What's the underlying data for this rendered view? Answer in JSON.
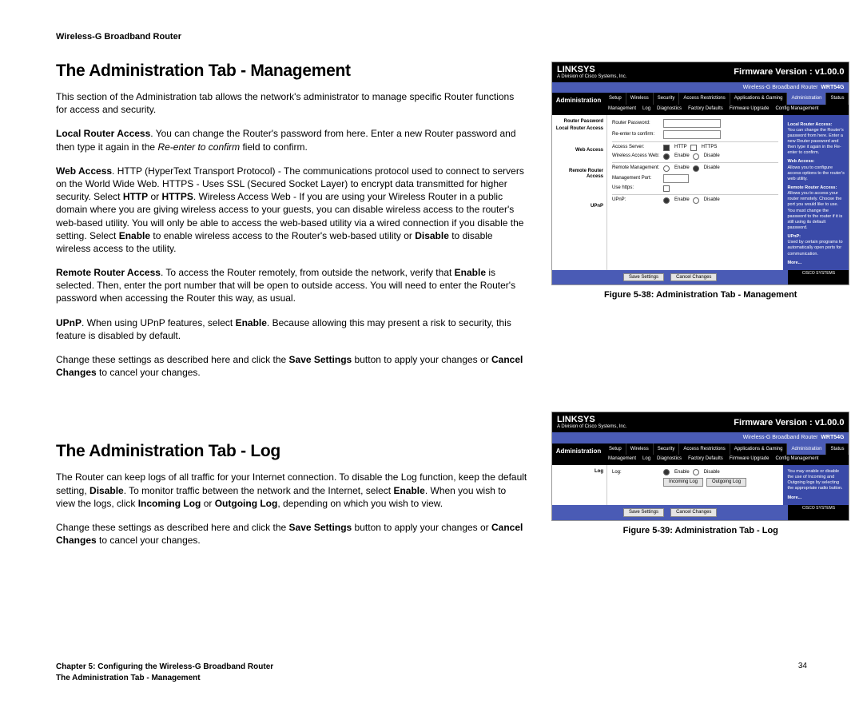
{
  "header": "Wireless-G Broadband Router",
  "section1": {
    "title": "The Administration Tab - Management",
    "intro": "This section of the Administration tab allows the network's administrator to manage specific Router functions for access and security.",
    "local_label": "Local Router Access",
    "local_text1": ". You can change the Router's password from here. Enter a new Router password and then type it again in the ",
    "local_em": "Re-enter to confirm",
    "local_text2": " field to confirm.",
    "web_label": "Web Access",
    "web_text1": ". HTTP (HyperText Transport Protocol) - The communications protocol used to connect to servers on the World Wide Web. HTTPS - Uses SSL (Secured Socket Layer) to encrypt data transmitted for higher security. Select ",
    "web_b1": "HTTP",
    "web_text2": " or ",
    "web_b2": "HTTPS",
    "web_text3": ". Wireless Access Web - If you are using your Wireless Router in a public domain where you are giving wireless access to your guests, you can disable wireless access to the router's web-based utility. You will only be able to access the web-based utility via a wired connection if you disable the setting. Select ",
    "web_b3": "Enable",
    "web_text4": " to enable wireless access to the Router's web-based utility or ",
    "web_b4": "Disable",
    "web_text5": " to disable wireless access to the utility.",
    "remote_label": "Remote Router Access",
    "remote_text1": ". To access the Router remotely, from outside the network, verify that ",
    "remote_b1": "Enable",
    "remote_text2": " is selected. Then, enter the port number that will be open to outside access. You will need to enter the Router's password when accessing the Router this way, as usual.",
    "upnp_label": "UPnP",
    "upnp_text1": ". When using UPnP features, select ",
    "upnp_b1": "Enable",
    "upnp_text2": ". Because allowing this may present a risk to security, this feature is disabled by default.",
    "save1": "Change these settings as described here and click the ",
    "save_b1": "Save Settings",
    "save2": " button to apply your changes or ",
    "save_b2": "Cancel Changes",
    "save3": " to cancel your changes."
  },
  "section2": {
    "title": "The Administration Tab - Log",
    "p1a": "The Router can keep logs of all traffic for your Internet connection. To disable the Log function, keep the default setting, ",
    "p1b": "Disable",
    "p1c": ". To monitor traffic between the network and the Internet, select ",
    "p1d": "Enable",
    "p1e": ". When you wish to view the logs, click ",
    "p1f": "Incoming Log",
    "p1g": " or ",
    "p1h": "Outgoing Log",
    "p1i": ", depending on which you wish to view.",
    "save1": "Change these settings as described here and click the ",
    "save_b1": "Save Settings",
    "save2": " button to apply your changes or ",
    "save_b2": "Cancel Changes",
    "save3": " to cancel your changes."
  },
  "figures": {
    "f1_caption": "Figure 5-38: Administration Tab - Management",
    "f2_caption": "Figure 5-39: Administration Tab - Log"
  },
  "router": {
    "brand": "LINKSYS",
    "brand_sub": "A Division of Cisco Systems, Inc.",
    "product": "Wireless-G Broadband Router",
    "model": "WRT54G",
    "fw": "Firmware Version : v1.00.0",
    "main_tab": "Administration",
    "tabs": [
      "Setup",
      "Wireless",
      "Security",
      "Access Restrictions",
      "Applications & Gaming",
      "Administration",
      "Status"
    ],
    "subtabs": [
      "Management",
      "Log",
      "Diagnostics",
      "Factory Defaults",
      "Firmware Upgrade",
      "Config Management"
    ],
    "groups": {
      "router_password": "Router Password",
      "local_access": "Local Router Access",
      "web_access": "Web Access",
      "remote_access": "Remote Router Access",
      "upnp": "UPnP",
      "log": "Log"
    },
    "fields": {
      "router_password": "Router Password:",
      "reenter": "Re-enter to confirm:",
      "access_server": "Access Server:",
      "http": "HTTP",
      "https": "HTTPS",
      "wireless_access": "Wireless Access Web:",
      "enable": "Enable",
      "disable": "Disable",
      "remote_mgmt": "Remote Management:",
      "mgmt_port": "Management Port:",
      "use_https": "Use https:",
      "upnp": "UPnP:",
      "log": "Log:",
      "incoming": "Incoming Log",
      "outgoing": "Outgoing Log"
    },
    "help": {
      "local_t": "Local Router Access:",
      "local_b": "You can change the Router's password from here. Enter a new Router password and then type it again in the Re-enter to confirm.",
      "web_t": "Web Access:",
      "web_b": "Allows you to configure access options to the router's web utility.",
      "remote_t": "Remote Router Access:",
      "remote_b": "Allows you to access your router remotely. Choose the port you would like to use. You must change the password to the router if it is still using its default password.",
      "upnp_t": "UPnP:",
      "upnp_b": "Used by certain programs to automatically open ports for communication.",
      "more": "More...",
      "log_t": "You may enable or disable the use of Incoming and Outgoing logs by selecting the appropriate radio button."
    },
    "buttons": {
      "save": "Save Settings",
      "cancel": "Cancel Changes"
    },
    "cisco": "CISCO SYSTEMS"
  },
  "footer": {
    "line1a": "Chapter 5: Configuring the Wireless-G Broadband Router",
    "line1b": "The Administration Tab - Management",
    "page": "34"
  }
}
